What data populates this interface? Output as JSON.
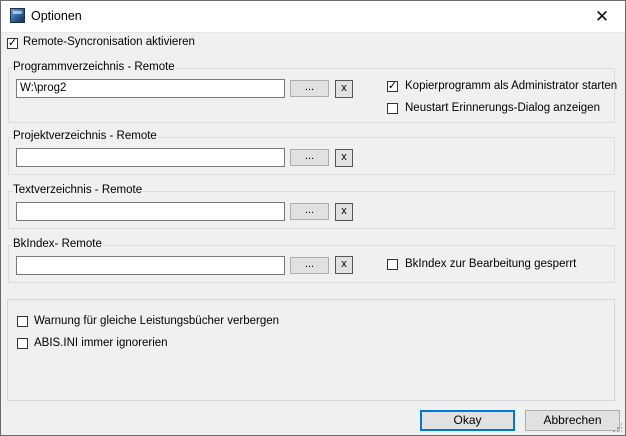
{
  "window": {
    "title": "Optionen",
    "close_glyph": "✕"
  },
  "remote_sync": {
    "label": "Remote-Syncronisation aktivieren",
    "checked": true
  },
  "groups": {
    "programm": {
      "title": "Programmverzeichnis - Remote",
      "value": "W:\\prog2",
      "browse_label": "...",
      "clear_label": "x",
      "admin_checkbox": {
        "label": "Kopierprogramm als Administrator starten",
        "checked": true
      },
      "restart_checkbox": {
        "label": "Neustart Erinnerungs-Dialog anzeigen",
        "checked": false
      }
    },
    "projekt": {
      "title": "Projektverzeichnis - Remote",
      "value": "",
      "browse_label": "...",
      "clear_label": "x"
    },
    "text": {
      "title": "Textverzeichnis - Remote",
      "value": "",
      "browse_label": "...",
      "clear_label": "x"
    },
    "bkindex": {
      "title": "BkIndex- Remote",
      "value": "",
      "browse_label": "...",
      "clear_label": "x",
      "locked_checkbox": {
        "label": "BkIndex  zur Bearbeitung gesperrt",
        "checked": false
      }
    }
  },
  "options": {
    "warn_duplicate": {
      "label": "Warnung für gleiche Leistungsbücher verbergen",
      "checked": false
    },
    "ignore_abis": {
      "label": "ABIS.INI immer ignorerien",
      "checked": false
    }
  },
  "buttons": {
    "ok": "Okay",
    "cancel": "Abbrechen"
  },
  "colors": {
    "accent": "#0078d7",
    "background": "#f0f0f0"
  },
  "icons": {
    "app": "app-window-icon",
    "close": "close-icon",
    "check": "checkmark-icon"
  }
}
